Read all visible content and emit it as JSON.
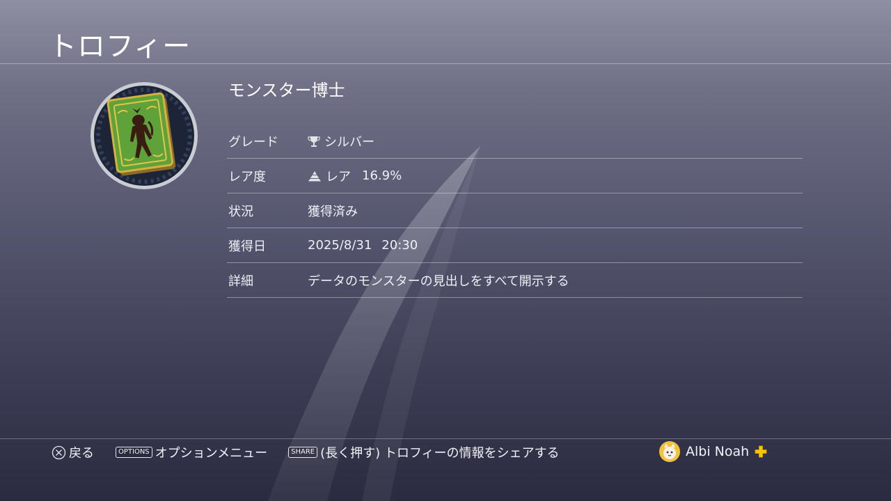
{
  "header": {
    "title": "トロフィー"
  },
  "trophy": {
    "name": "モンスター博士",
    "icon": "monster-book-icon",
    "rows": [
      {
        "label": "グレード",
        "value": "シルバー",
        "icon": "trophy-icon"
      },
      {
        "label": "レア度",
        "value": "レア",
        "extra": "16.9%",
        "icon": "rarity-pyramid-icon"
      },
      {
        "label": "状況",
        "value": "獲得済み"
      },
      {
        "label": "獲得日",
        "date": "2025/8/31",
        "time": "20:30"
      },
      {
        "label": "詳細",
        "value": "データのモンスターの見出しをすべて開示する"
      }
    ]
  },
  "footer": {
    "back_label": "戻る",
    "options_key": "OPTIONS",
    "options_label": "オプションメニュー",
    "share_key": "SHARE",
    "share_label": "(長く押す) トロフィーの情報をシェアする"
  },
  "user": {
    "name": "Albi Noah",
    "plus_icon": "ps-plus-icon"
  },
  "colors": {
    "plus_yellow": "#f5c500",
    "book_green": "#5fa23a"
  }
}
